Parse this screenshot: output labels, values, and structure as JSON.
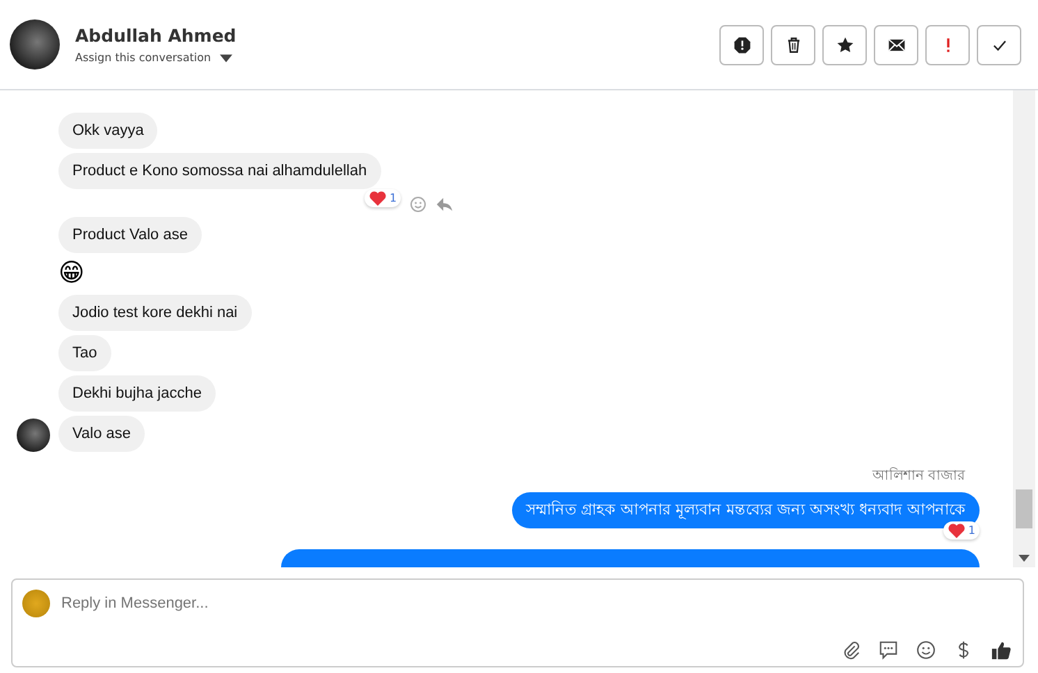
{
  "header": {
    "name": "Abdullah Ahmed",
    "assign": "Assign this conversation",
    "actions": [
      {
        "kind": "spam"
      },
      {
        "kind": "delete"
      },
      {
        "kind": "star"
      },
      {
        "kind": "unread"
      },
      {
        "kind": "priority"
      },
      {
        "kind": "done"
      }
    ]
  },
  "messages": [
    {
      "outgoing": false,
      "kind": "text",
      "text": "Okk vayya"
    },
    {
      "outgoing": false,
      "kind": "text",
      "text": "Product e Kono somossa nai alhamdulellah",
      "reaction": "1",
      "actions": true
    },
    {
      "outgoing": false,
      "kind": "text",
      "text": "Product Valo ase"
    },
    {
      "outgoing": false,
      "kind": "emoji",
      "text": "😁"
    },
    {
      "outgoing": false,
      "kind": "text",
      "text": "Jodio test kore dekhi nai"
    },
    {
      "outgoing": false,
      "kind": "text",
      "text": "Tao"
    },
    {
      "outgoing": false,
      "kind": "text",
      "text": "Dekhi bujha jacche"
    },
    {
      "outgoing": false,
      "kind": "text",
      "text": "Valo ase",
      "avatar": true
    },
    {
      "outgoing": true,
      "kind": "text",
      "sender": "আলিশান  বাজার",
      "text": "সম্মানিত গ্রাহক আপনার মূল্যবান মন্তব্যের জন্য অসংখ্য ধন্যবাদ আপনাকে",
      "reaction": "1"
    },
    {
      "outgoing": true,
      "kind": "clipped"
    }
  ],
  "composer": {
    "placeholder": "Reply in Messenger..."
  }
}
